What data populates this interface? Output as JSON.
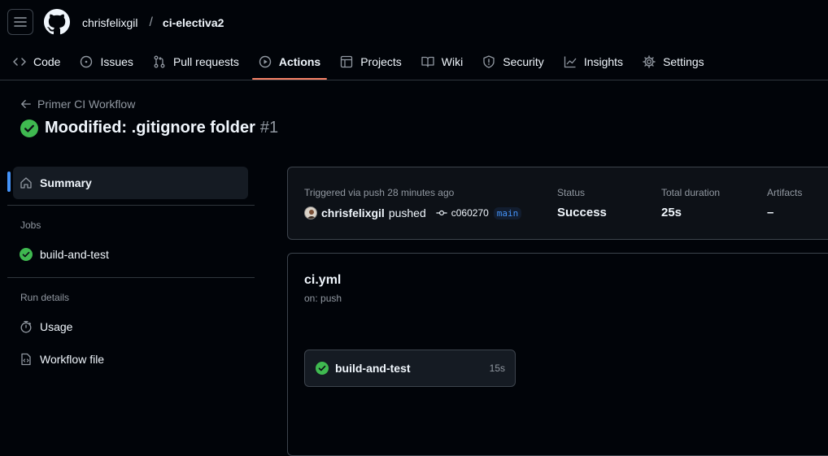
{
  "header": {
    "owner": "chrisfelixgil",
    "separator": "/",
    "repo": "ci-electiva2"
  },
  "tabs": [
    {
      "label": "Code",
      "icon": "code-icon"
    },
    {
      "label": "Issues",
      "icon": "issue-icon"
    },
    {
      "label": "Pull requests",
      "icon": "pull-request-icon"
    },
    {
      "label": "Actions",
      "icon": "play-icon",
      "active": true
    },
    {
      "label": "Projects",
      "icon": "table-icon"
    },
    {
      "label": "Wiki",
      "icon": "book-icon"
    },
    {
      "label": "Security",
      "icon": "shield-icon"
    },
    {
      "label": "Insights",
      "icon": "graph-icon"
    },
    {
      "label": "Settings",
      "icon": "gear-icon"
    }
  ],
  "run": {
    "back_label": "Primer CI Workflow",
    "title": "Moodified: .gitignore folder",
    "number": "#1"
  },
  "sidebar": {
    "summary_label": "Summary",
    "jobs_heading": "Jobs",
    "job_label": "build-and-test",
    "run_details_heading": "Run details",
    "usage_label": "Usage",
    "workflow_file_label": "Workflow file"
  },
  "summary": {
    "triggered": "Triggered via push 28 minutes ago",
    "user": "chrisfelixgil",
    "action": "pushed",
    "commit": "c060270",
    "branch": "main",
    "status_label": "Status",
    "status_value": "Success",
    "duration_label": "Total duration",
    "duration_value": "25s",
    "artifacts_label": "Artifacts",
    "artifacts_value": "–"
  },
  "workflow": {
    "file": "ci.yml",
    "on": "on: push",
    "job_name": "build-and-test",
    "job_duration": "15s"
  },
  "colors": {
    "success": "#3fb950",
    "accent": "#f78166",
    "link": "#4493f8"
  }
}
